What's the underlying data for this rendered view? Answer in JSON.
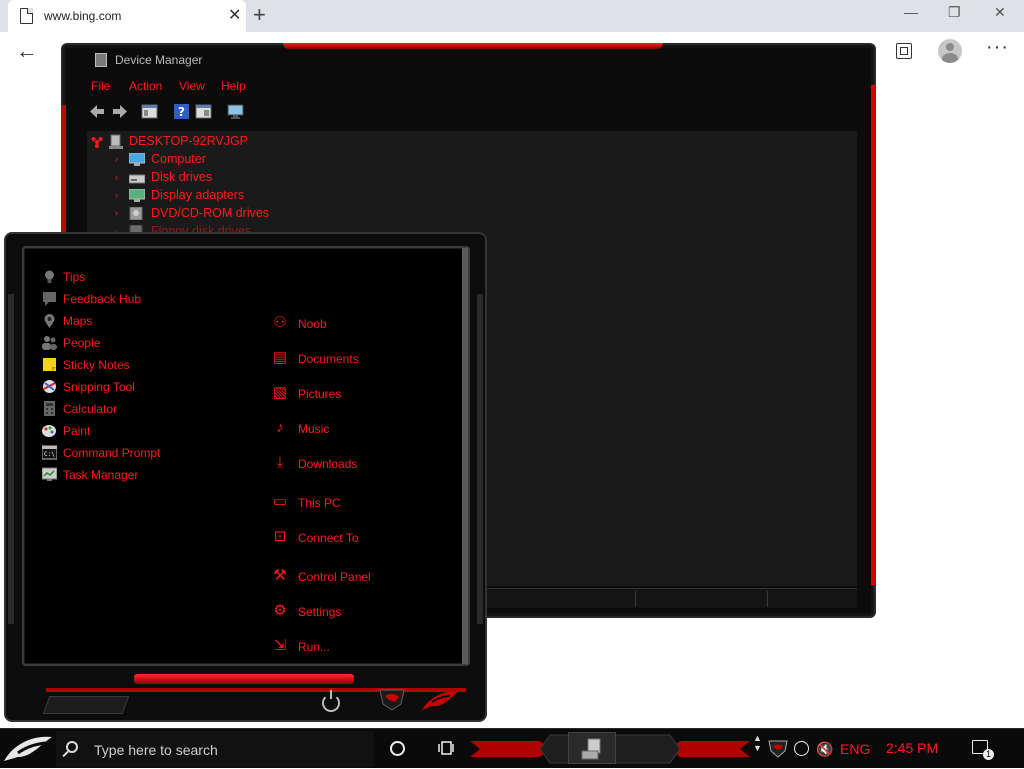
{
  "browser": {
    "tab_title": "www.bing.com",
    "tab_close": "✕",
    "new_tab": "+",
    "minimize": "—",
    "maximize": "❐",
    "close": "✕",
    "back": "←",
    "more": "···"
  },
  "device_manager": {
    "title": "Device Manager",
    "menu": [
      "File",
      "Action",
      "View",
      "Help"
    ],
    "root": "DESKTOP-92RVJGP",
    "tree": [
      {
        "label": "Computer",
        "icon": "monitor-icon"
      },
      {
        "label": "Disk drives",
        "icon": "disk-drive-icon"
      },
      {
        "label": "Display adapters",
        "icon": "display-adapter-icon"
      },
      {
        "label": "DVD/CD-ROM drives",
        "icon": "dvd-drive-icon"
      },
      {
        "label": "Floppy disk drives",
        "icon": "floppy-drive-icon"
      }
    ]
  },
  "start_menu": {
    "apps": [
      {
        "label": "Tips",
        "icon": "lightbulb-icon"
      },
      {
        "label": "Feedback Hub",
        "icon": "feedback-icon"
      },
      {
        "label": "Maps",
        "icon": "maps-icon"
      },
      {
        "label": "People",
        "icon": "people-icon"
      },
      {
        "label": "Sticky Notes",
        "icon": "sticky-notes-icon"
      },
      {
        "label": "Snipping Tool",
        "icon": "snipping-tool-icon"
      },
      {
        "label": "Calculator",
        "icon": "calculator-icon"
      },
      {
        "label": "Paint",
        "icon": "paint-icon"
      },
      {
        "label": "Command Prompt",
        "icon": "command-prompt-icon"
      },
      {
        "label": "Task Manager",
        "icon": "task-manager-icon"
      }
    ],
    "places": [
      {
        "label": "Noob",
        "icon": "user-icon",
        "glyph": "⚇"
      },
      {
        "label": "Documents",
        "icon": "documents-icon",
        "glyph": "▤"
      },
      {
        "label": "Pictures",
        "icon": "pictures-icon",
        "glyph": "▧"
      },
      {
        "label": "Music",
        "icon": "music-icon",
        "glyph": "♪"
      },
      {
        "label": "Downloads",
        "icon": "downloads-icon",
        "glyph": "⤓"
      },
      {
        "label": "This PC",
        "icon": "this-pc-icon",
        "glyph": "▭"
      },
      {
        "label": "Connect To",
        "icon": "connect-to-icon",
        "glyph": "⊡"
      },
      {
        "label": "Control Panel",
        "icon": "control-panel-icon",
        "glyph": "⚒"
      },
      {
        "label": "Settings",
        "icon": "settings-icon",
        "glyph": "⚙"
      },
      {
        "label": "Run...",
        "icon": "run-icon",
        "glyph": "⇲"
      }
    ]
  },
  "taskbar": {
    "search_placeholder": "Type here to search",
    "language": "ENG",
    "time": "2:45 PM",
    "notifications": "1",
    "volume": "🔇"
  },
  "colors": {
    "accent": "#ff1a1a",
    "window_bg": "#1a1a1a",
    "taskbar_bg": "#0a0a0a"
  }
}
